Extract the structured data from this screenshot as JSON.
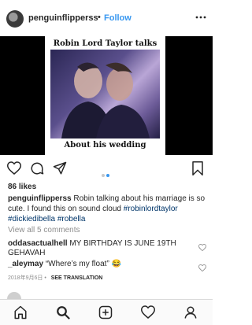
{
  "header": {
    "username": "penguinflipperss",
    "separator": "•",
    "follow_label": "Follow",
    "more_icon": "more-icon"
  },
  "post_image": {
    "title": "Robin Lord Taylor talks",
    "subtitle": "About his wedding"
  },
  "carousel": {
    "count": 2,
    "active_index": 1
  },
  "likes": "86 likes",
  "caption": {
    "username": "penguinflipperss",
    "text": "Robin talking about his marriage is so cute. I found this on sound cloud",
    "tags": [
      "#robinlordtaylor",
      "#dickiedibella",
      "#robella"
    ]
  },
  "view_all": "View all 5 comments",
  "comments": [
    {
      "username": "oddasactualhell",
      "text": "MY BIRTHDAY IS JUNE 19TH GEHAVAH"
    },
    {
      "username": "_aleymay",
      "text": "“Where’s my float” 😂"
    }
  ],
  "meta": {
    "date": "2018年9月6日",
    "translate_label": "SEE TRANSLATION"
  },
  "tabbar": [
    "home-icon",
    "search-icon",
    "add-post-icon",
    "activity-heart-icon",
    "profile-icon"
  ]
}
